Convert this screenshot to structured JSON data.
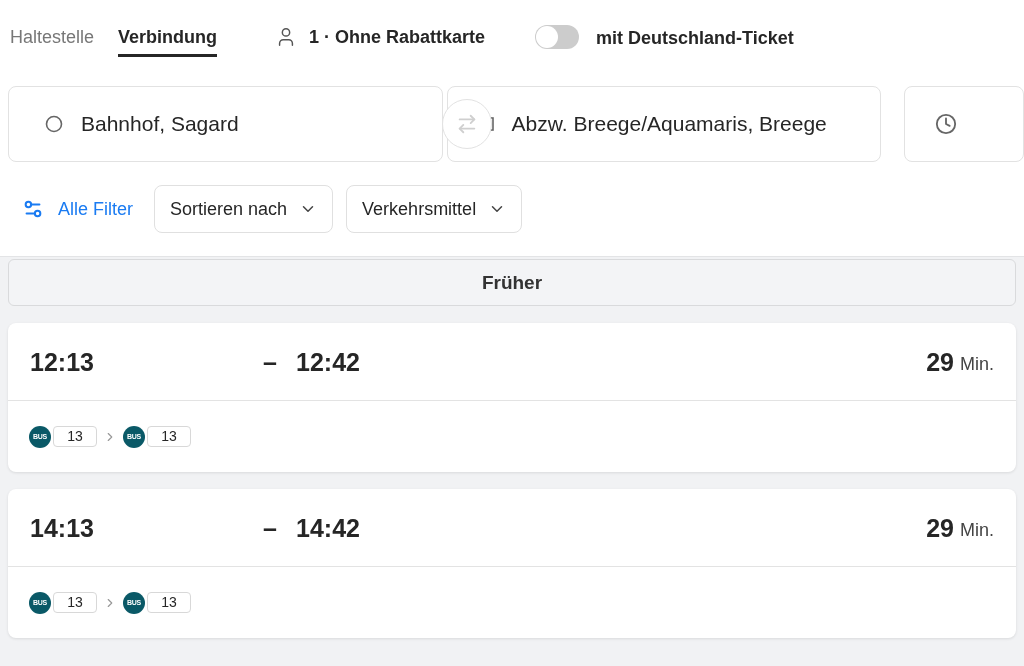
{
  "tabs": [
    {
      "label": "Haltestelle",
      "selected": false
    },
    {
      "label": "Verbindung",
      "selected": true
    }
  ],
  "passengers": {
    "label": "1 · Ohne Rabattkarte"
  },
  "deutschland_ticket": {
    "label": "mit Deutschland-Ticket",
    "on": false
  },
  "search": {
    "from": {
      "value": "Bahnhof, Sagard"
    },
    "to": {
      "value": "Abzw. Breege/Aquamaris, Breege"
    }
  },
  "filters": {
    "all_filters": "Alle Filter",
    "dropdowns": [
      "Sortieren nach",
      "Verkehrsmittel"
    ]
  },
  "earlier_button": "Früher",
  "connections": [
    {
      "departure": "12:13",
      "separator": "–",
      "arrival": "12:42",
      "duration": "29",
      "duration_unit": "Min.",
      "legs": [
        {
          "mode": "BUS",
          "line": "13"
        },
        {
          "mode": "BUS",
          "line": "13"
        }
      ]
    },
    {
      "departure": "14:13",
      "separator": "–",
      "arrival": "14:42",
      "duration": "29",
      "duration_unit": "Min.",
      "legs": [
        {
          "mode": "BUS",
          "line": "13"
        },
        {
          "mode": "BUS",
          "line": "13"
        }
      ]
    }
  ]
}
